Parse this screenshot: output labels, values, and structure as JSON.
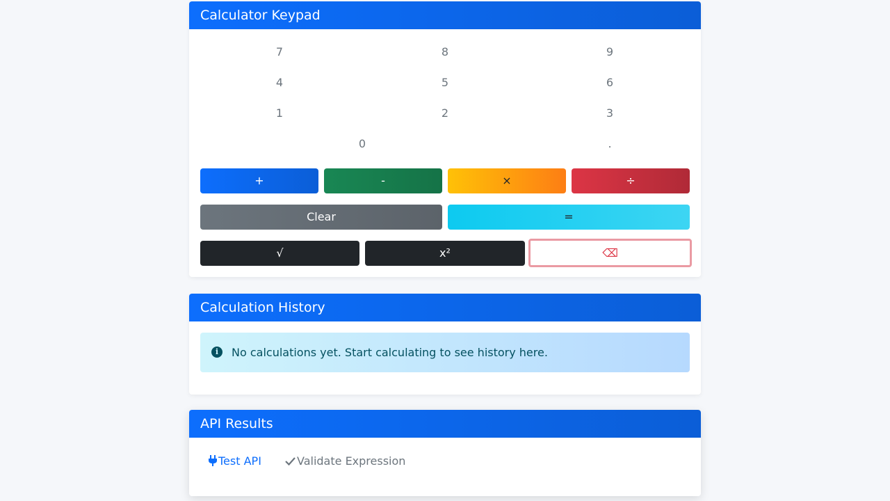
{
  "keypad": {
    "title": "Calculator Keypad",
    "digits": [
      "7",
      "8",
      "9",
      "4",
      "5",
      "6",
      "1",
      "2",
      "3",
      "0",
      "."
    ],
    "ops": {
      "plus": "+",
      "minus": "-",
      "times": "×",
      "divide": "÷"
    },
    "clear": "Clear",
    "equals": "=",
    "sqrt": "√",
    "square": "x²",
    "backspace": "⌫"
  },
  "history": {
    "title": "Calculation History",
    "empty_message": "No calculations yet. Start calculating to see history here.",
    "icon": "info-circle-icon"
  },
  "api": {
    "title": "API Results",
    "tabs": [
      {
        "label": "Test API",
        "icon": "plug-icon",
        "active": true
      },
      {
        "label": "Validate Expression",
        "icon": "check-icon",
        "active": false
      }
    ]
  },
  "colors": {
    "primary": "#0d6efd",
    "success": "#198754",
    "warning": "#ffc107",
    "danger": "#dc3545",
    "secondary": "#6c757d",
    "info": "#0dcaf0",
    "dark": "#212529"
  }
}
